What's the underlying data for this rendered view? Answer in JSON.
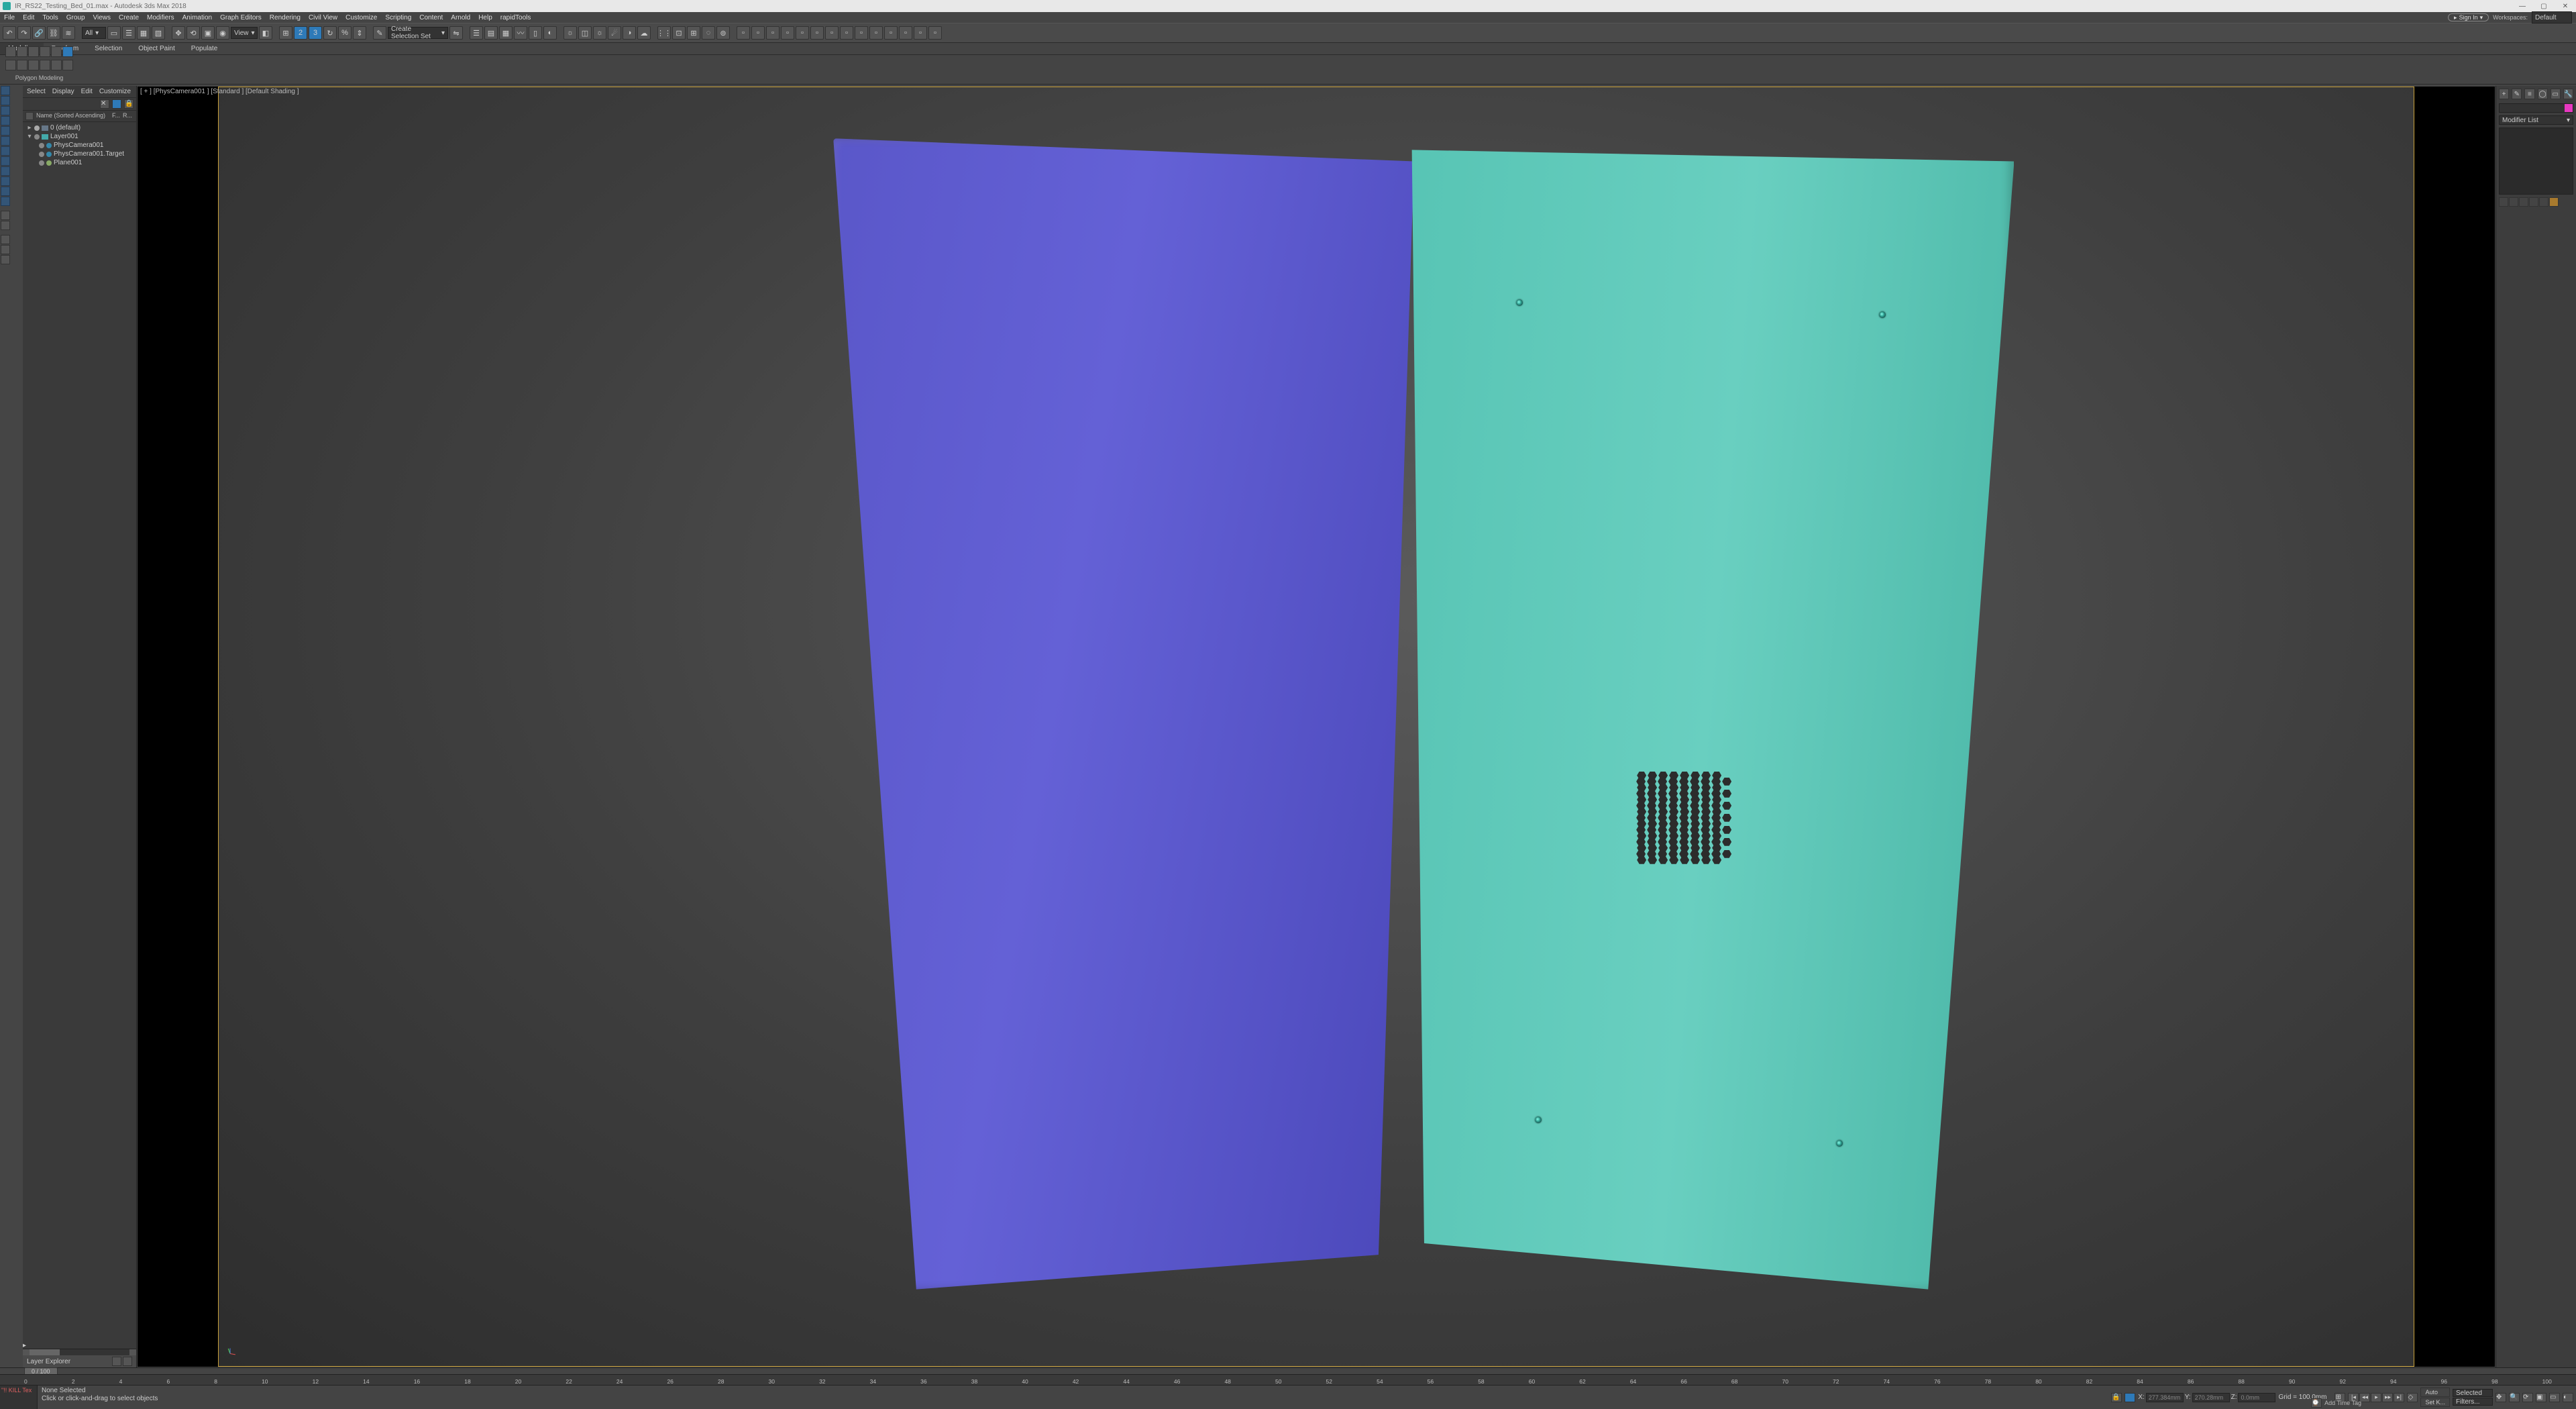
{
  "titlebar": {
    "filename": "IR_RS22_Testing_Bed_01.max",
    "app": "Autodesk 3ds Max 2018"
  },
  "signin": {
    "label": "Sign In"
  },
  "workspaces": {
    "label": "Workspaces:",
    "value": "Default"
  },
  "menubar": [
    "File",
    "Edit",
    "Tools",
    "Group",
    "Views",
    "Create",
    "Modifiers",
    "Animation",
    "Graph Editors",
    "Rendering",
    "Civil View",
    "Customize",
    "Scripting",
    "Content",
    "Arnold",
    "Help",
    "rapidTools"
  ],
  "toolbar": {
    "filter_dropdown": "All",
    "view_dropdown": "View",
    "selset_dropdown": "Create Selection Set"
  },
  "ribbon": {
    "tabs": [
      "Modeling",
      "Freeform",
      "Selection",
      "Object Paint",
      "Populate"
    ],
    "active": 0,
    "sublabel": "Polygon Modeling"
  },
  "explorer": {
    "menu": [
      "Select",
      "Display",
      "Edit",
      "Customize"
    ],
    "header_col": "Name (Sorted Ascending)",
    "header_frozen": "F...",
    "header_render": "R...",
    "tree": [
      {
        "depth": 0,
        "twist": "▸",
        "icon": "world",
        "label": "0 (default)"
      },
      {
        "depth": 0,
        "twist": "▾",
        "icon": "layer",
        "label": "Layer001"
      },
      {
        "depth": 1,
        "twist": "",
        "icon": "cam",
        "label": "PhysCamera001"
      },
      {
        "depth": 1,
        "twist": "",
        "icon": "cam",
        "label": "PhysCamera001.Target"
      },
      {
        "depth": 1,
        "twist": "",
        "icon": "obj",
        "label": "Plane001"
      }
    ],
    "footer_title": "Layer Explorer"
  },
  "viewport": {
    "label": "[ + ] [PhysCamera001 ] [Standard ] [Default Shading ]"
  },
  "cmdpanel": {
    "modifier_list": "Modifier List"
  },
  "timeslider": {
    "label": "0 / 100"
  },
  "timeline_ticks": [
    "0",
    "2",
    "4",
    "6",
    "8",
    "10",
    "12",
    "14",
    "16",
    "18",
    "20",
    "22",
    "24",
    "26",
    "28",
    "30",
    "32",
    "34",
    "36",
    "38",
    "40",
    "42",
    "44",
    "46",
    "48",
    "50",
    "52",
    "54",
    "56",
    "58",
    "60",
    "62",
    "64",
    "66",
    "68",
    "70",
    "72",
    "74",
    "76",
    "78",
    "80",
    "82",
    "84",
    "86",
    "88",
    "90",
    "92",
    "94",
    "96",
    "98",
    "100"
  ],
  "status": {
    "kill": "\"!! KILL Tex",
    "selection": "None Selected",
    "prompt": "Click or click-and-drag to select objects",
    "x": "277.384mm",
    "y": "270.28mm",
    "z": "0.0mm",
    "grid": "Grid = 100.0mm",
    "addtag": "Add Time Tag",
    "auto": "Auto",
    "setkey": "Set K...",
    "seldrop": "Selected",
    "filters": "Filters..."
  }
}
